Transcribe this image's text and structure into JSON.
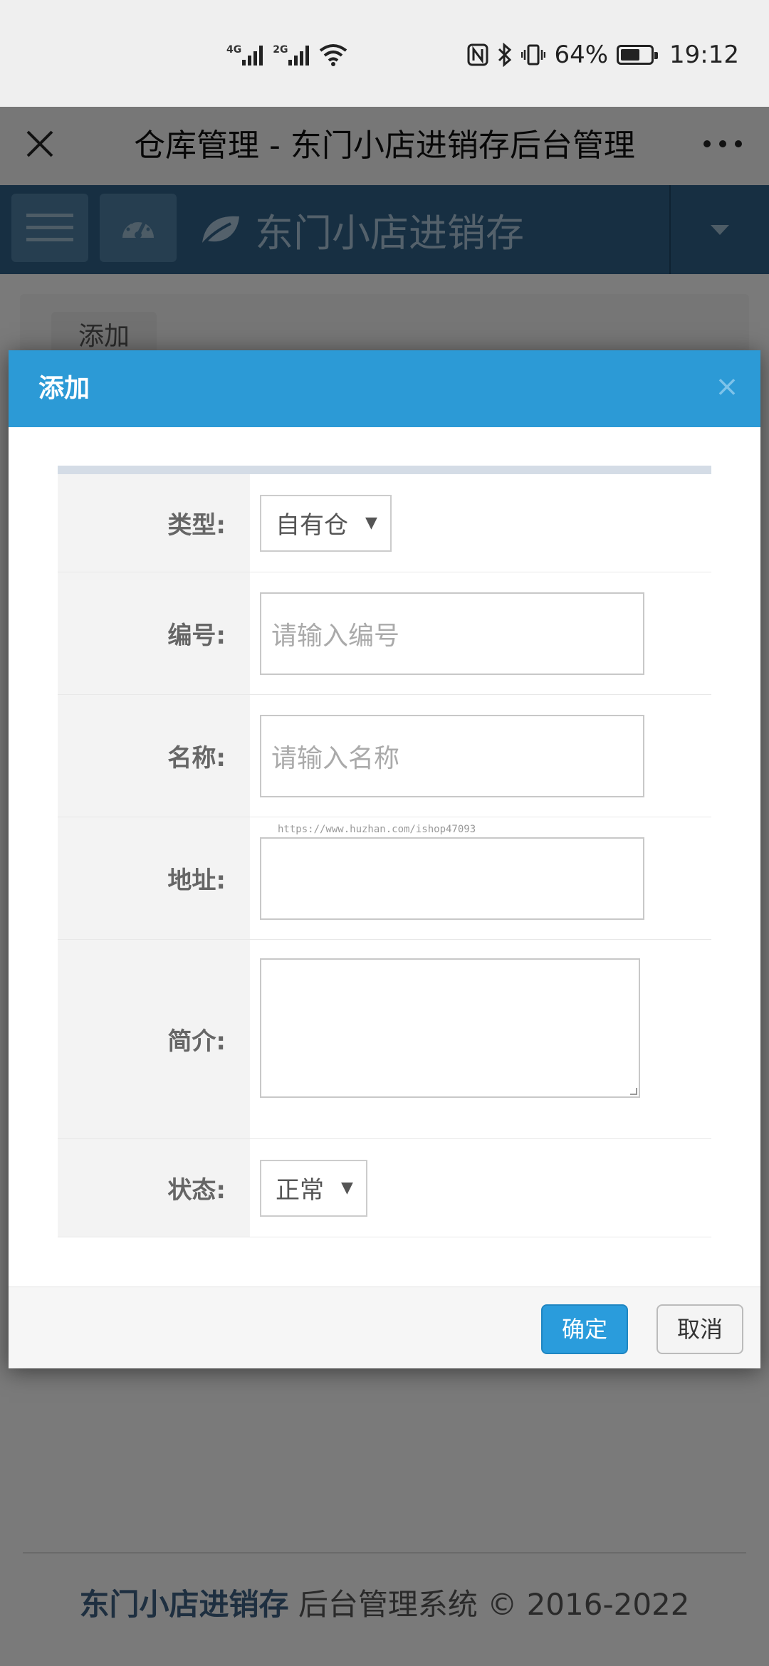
{
  "status_bar": {
    "net_1": "4G",
    "net_2": "2G",
    "battery_text": "64%",
    "battery_level": 0.64,
    "time": "19:12"
  },
  "title_bar": {
    "title": "仓库管理 - 东门小店进销存后台管理"
  },
  "navbar": {
    "brand": "东门小店进销存"
  },
  "page": {
    "add_button": "添加",
    "footer_brand": "东门小店进销存",
    "footer_rest": " 后台管理系统 © 2016-2022"
  },
  "modal": {
    "title": "添加",
    "close": "×",
    "watermark": "https://www.huzhan.com/ishop47093",
    "fields": {
      "type": {
        "label": "类型:",
        "value": "自有仓"
      },
      "code": {
        "label": "编号:",
        "placeholder": "请输入编号"
      },
      "name": {
        "label": "名称:",
        "placeholder": "请输入名称"
      },
      "address": {
        "label": "地址:",
        "placeholder": ""
      },
      "intro": {
        "label": "简介:"
      },
      "status": {
        "label": "状态:",
        "value": "正常"
      }
    },
    "ok": "确定",
    "cancel": "取消"
  },
  "colors": {
    "navbar": "#2e5f85",
    "modal_header": "#2c9ad6",
    "primary_button": "#2a9cdc"
  }
}
